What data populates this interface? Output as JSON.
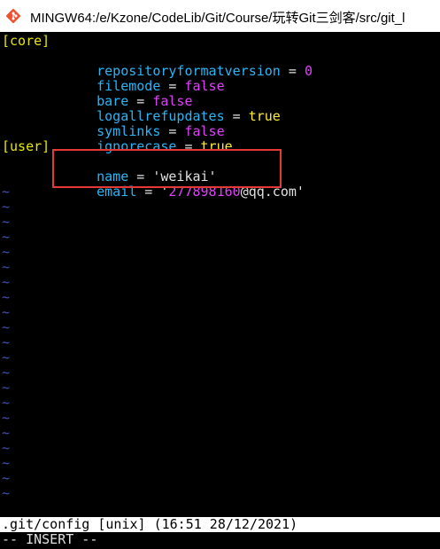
{
  "window": {
    "title": "MINGW64:/e/Kzone/CodeLib/Git/Course/玩转Git三剑客/src/git_l",
    "icon": "git-logo-icon"
  },
  "config": {
    "core_header": "[core]",
    "core_lines": [
      {
        "key": "repositoryformatversion",
        "eq": " = ",
        "value": "0"
      },
      {
        "key": "filemode",
        "eq": " = ",
        "value": "false"
      },
      {
        "key": "bare",
        "eq": " = ",
        "value": "false"
      },
      {
        "key": "logallrefupdates",
        "eq": " = ",
        "value": "true"
      },
      {
        "key": "symlinks",
        "eq": " = ",
        "value": "false"
      },
      {
        "key": "ignorecase",
        "eq": " = ",
        "value": "true"
      }
    ],
    "user_header": "[user]",
    "user_lines": [
      {
        "key": "name",
        "eq": " = ",
        "value": "'weikai'"
      },
      {
        "key": "email",
        "eq": " = ",
        "value_q1": "'",
        "value_num": "277898160",
        "value_rest": "@qq.com'"
      }
    ]
  },
  "tilde": "~",
  "status": {
    "file_info": ".git/config [unix] (16:51 28/12/2021)",
    "mode": "-- INSERT --"
  },
  "colors": {
    "section": "#e6e600",
    "key": "#29b6f6",
    "value": "#e040fb",
    "boolean": "#ffeb3b",
    "tilde": "#3f51b5",
    "highlight_box": "#e53935"
  }
}
